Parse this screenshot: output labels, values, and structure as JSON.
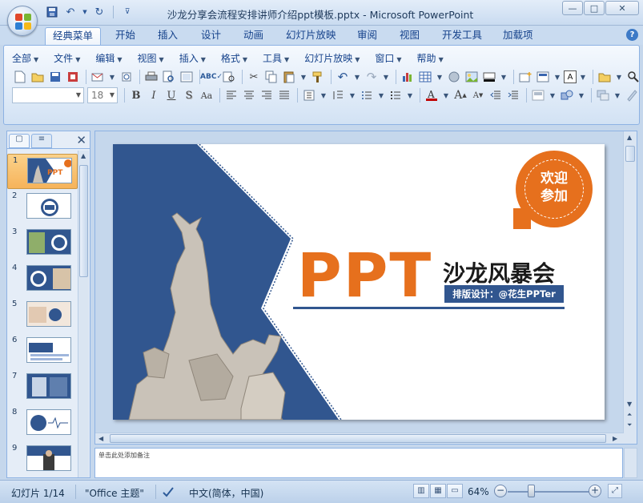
{
  "window": {
    "title": "沙龙分享会流程安排讲师介绍ppt模板.pptx - Microsoft PowerPoint",
    "minimize": "—",
    "maximize": "□",
    "close": "✕"
  },
  "ribbon_tabs": [
    "经典菜单",
    "开始",
    "插入",
    "设计",
    "动画",
    "幻灯片放映",
    "审阅",
    "视图",
    "开发工具",
    "加载项"
  ],
  "active_tab": "经典菜单",
  "help_label": "?",
  "classic_menu": [
    "全部",
    "文件",
    "编辑",
    "视图",
    "插入",
    "格式",
    "工具",
    "幻灯片放映",
    "窗口",
    "帮助"
  ],
  "format_bar": {
    "font_name": "",
    "font_size": "18",
    "bold": "B",
    "italic": "I",
    "underline": "U",
    "shadow": "S",
    "text_a": "Aa"
  },
  "slide_pane": {
    "slide_numbers": [
      "1",
      "2",
      "3",
      "4",
      "5",
      "6",
      "7",
      "8",
      "9"
    ],
    "selected": 1,
    "close": "✕"
  },
  "slide": {
    "headline": "PPT",
    "title": "沙龙风暴会",
    "designer": "排版设计：@花生PPTer",
    "badge_line1": "欢迎",
    "badge_line2": "参加",
    "colors": {
      "orange": "#e6701d",
      "navy": "#31568f",
      "text": "#1a1a1a"
    }
  },
  "notes": {
    "placeholder": "单击此处添加备注"
  },
  "statusbar": {
    "slide_info": "幻灯片 1/14",
    "theme": "\"Office 主题\"",
    "language": "中文(简体，中国)",
    "zoom": "64%",
    "zoom_level": 64
  }
}
